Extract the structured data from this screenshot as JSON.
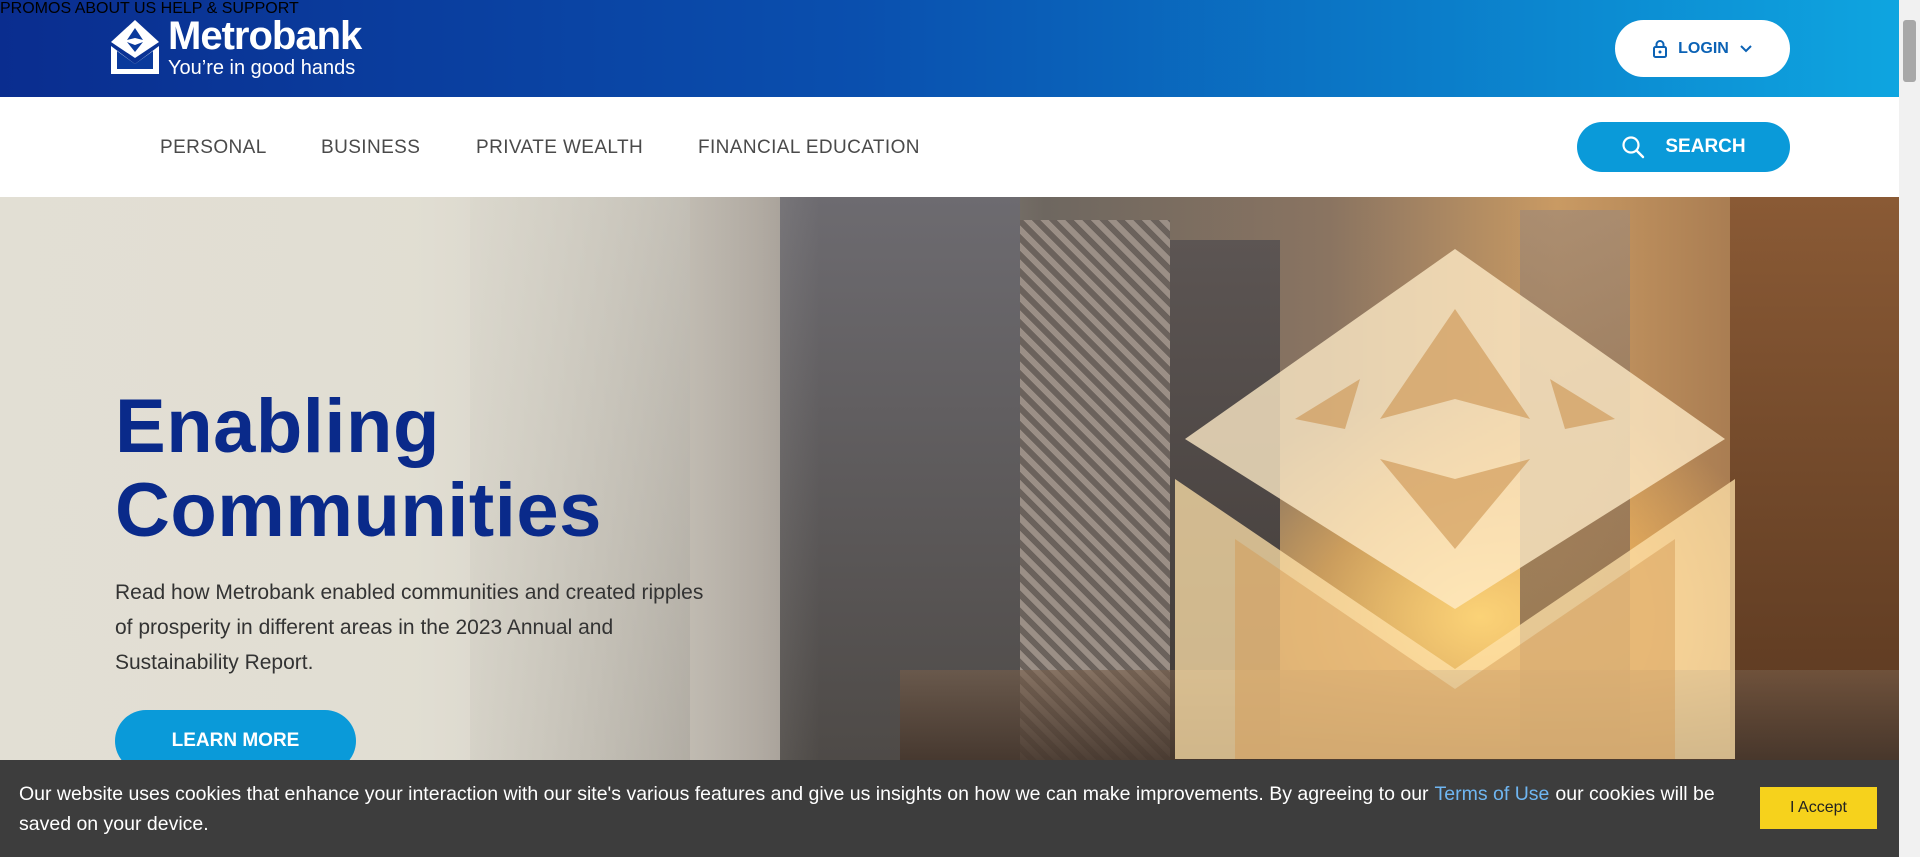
{
  "brand": {
    "name": "Metrobank",
    "tagline": "You’re in good hands"
  },
  "topnav": {
    "promos": "PROMOS",
    "about": "ABOUT US",
    "help": "HELP & SUPPORT",
    "login": "LOGIN"
  },
  "secnav": {
    "personal": "PERSONAL",
    "business": "BUSINESS",
    "private_wealth": "PRIVATE WEALTH",
    "financial_education": "FINANCIAL EDUCATION",
    "search": "SEARCH"
  },
  "hero": {
    "title_line1": "Enabling",
    "title_line2": "Communities",
    "description": "Read how Metrobank enabled communities and created ripples of prosperity in different areas in the 2023 Annual and Sustainability Report.",
    "cta": "LEARN MORE"
  },
  "cookie": {
    "text_before": "Our website uses cookies that enhance your interaction with our site's various features and give us insights on how we can make improvements. By agreeing to our",
    "link": "Terms of Use",
    "text_after": "our cookies will be saved on your device.",
    "accept": "I Accept"
  },
  "colors": {
    "brand_navy": "#0a2a8a",
    "accent_blue": "#0a9ad9",
    "cookie_bg": "#3d3d3d",
    "accept_yellow": "#f6d21c"
  },
  "icons": [
    "metrobank-logo-icon",
    "lock-icon",
    "chevron-down-icon",
    "search-icon"
  ]
}
